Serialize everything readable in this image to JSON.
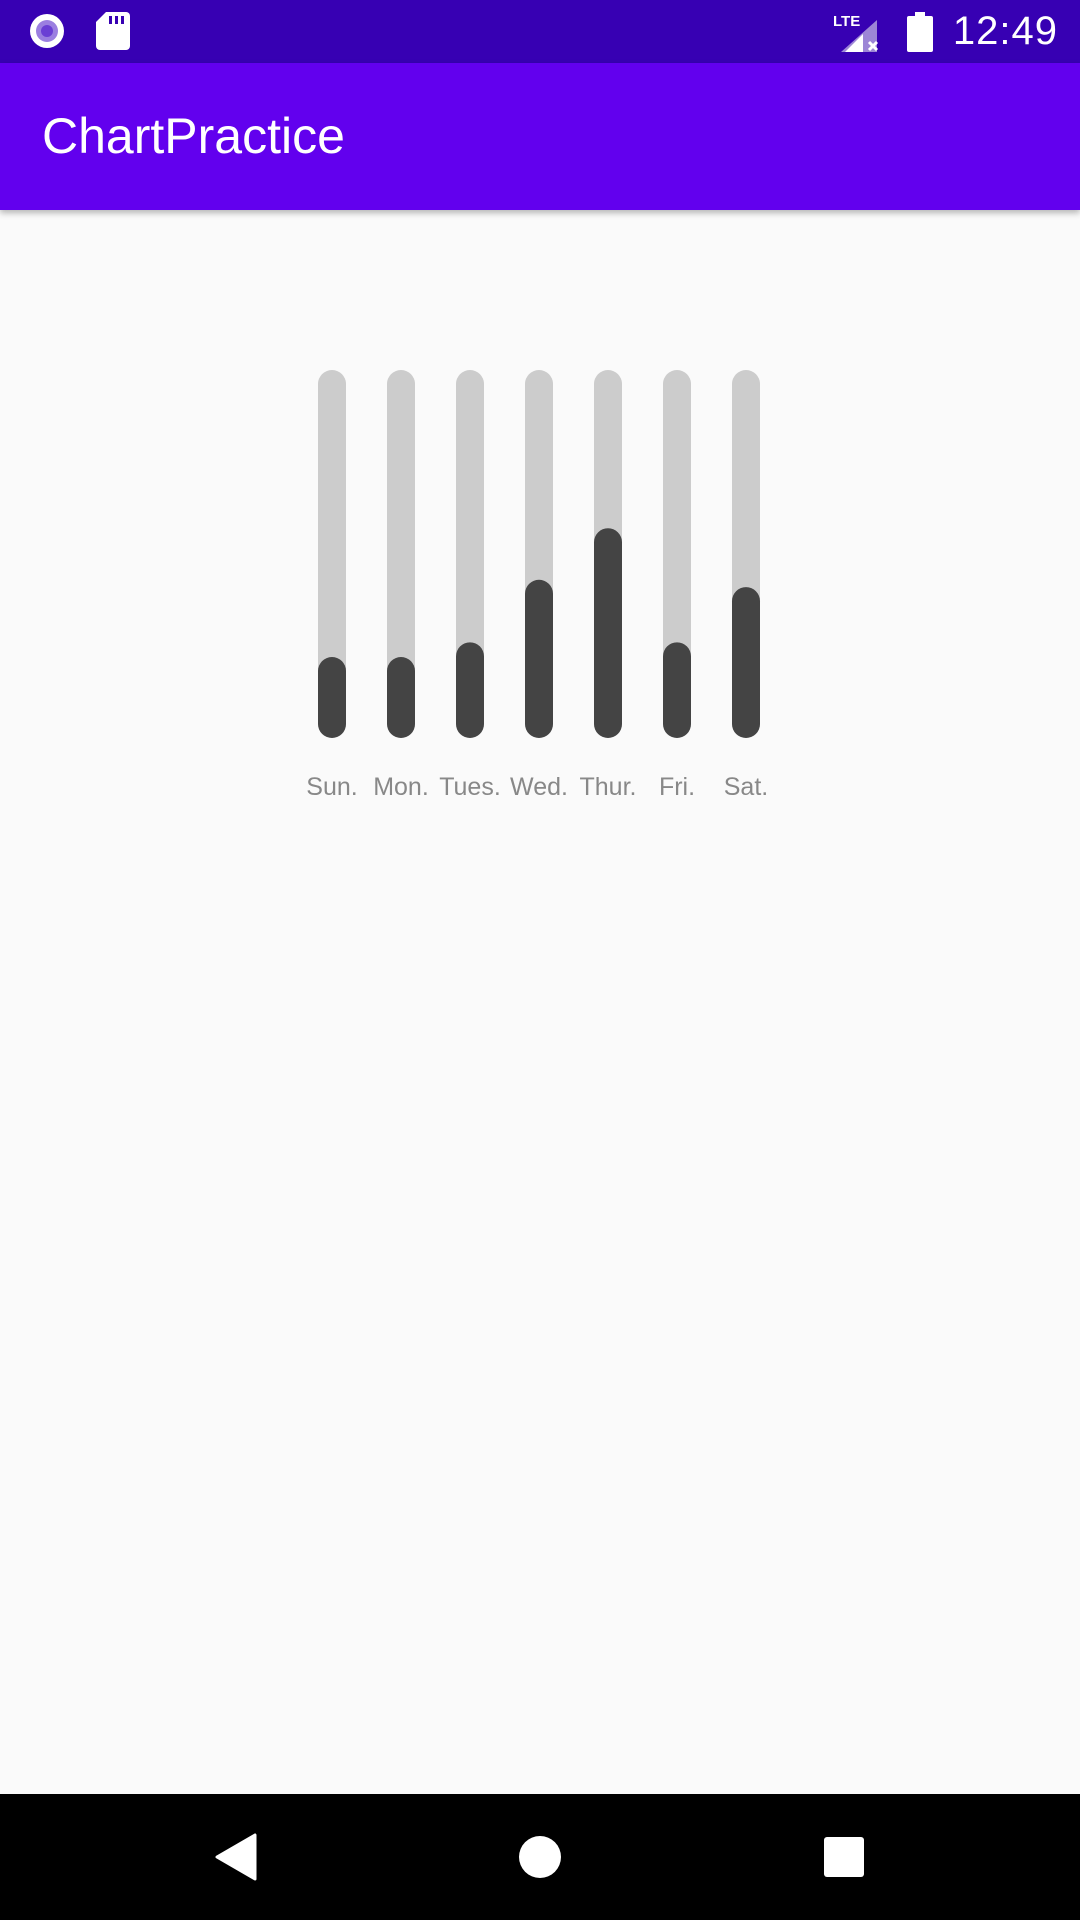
{
  "status_bar": {
    "time": "12:49",
    "network": "LTE",
    "icons": [
      "notification-circle-icon",
      "sd-card-icon",
      "signal-no-data-icon",
      "battery-icon"
    ]
  },
  "app_bar": {
    "title": "ChartPractice",
    "color": "#6200ee"
  },
  "colors": {
    "status_bar": "#3700b3",
    "track": "#cccccc",
    "fill": "#444444",
    "label": "#888888",
    "background": "#fafafa"
  },
  "chart_data": {
    "type": "bar",
    "categories": [
      "Sun.",
      "Mon.",
      "Tues.",
      "Wed.",
      "Thur.",
      "Fri.",
      "Sat."
    ],
    "values": [
      0.22,
      0.22,
      0.26,
      0.43,
      0.57,
      0.26,
      0.41
    ],
    "ylim": [
      0,
      1
    ],
    "grid": false
  },
  "nav_bar": {
    "buttons": [
      "back-icon",
      "home-icon",
      "recents-icon"
    ]
  }
}
